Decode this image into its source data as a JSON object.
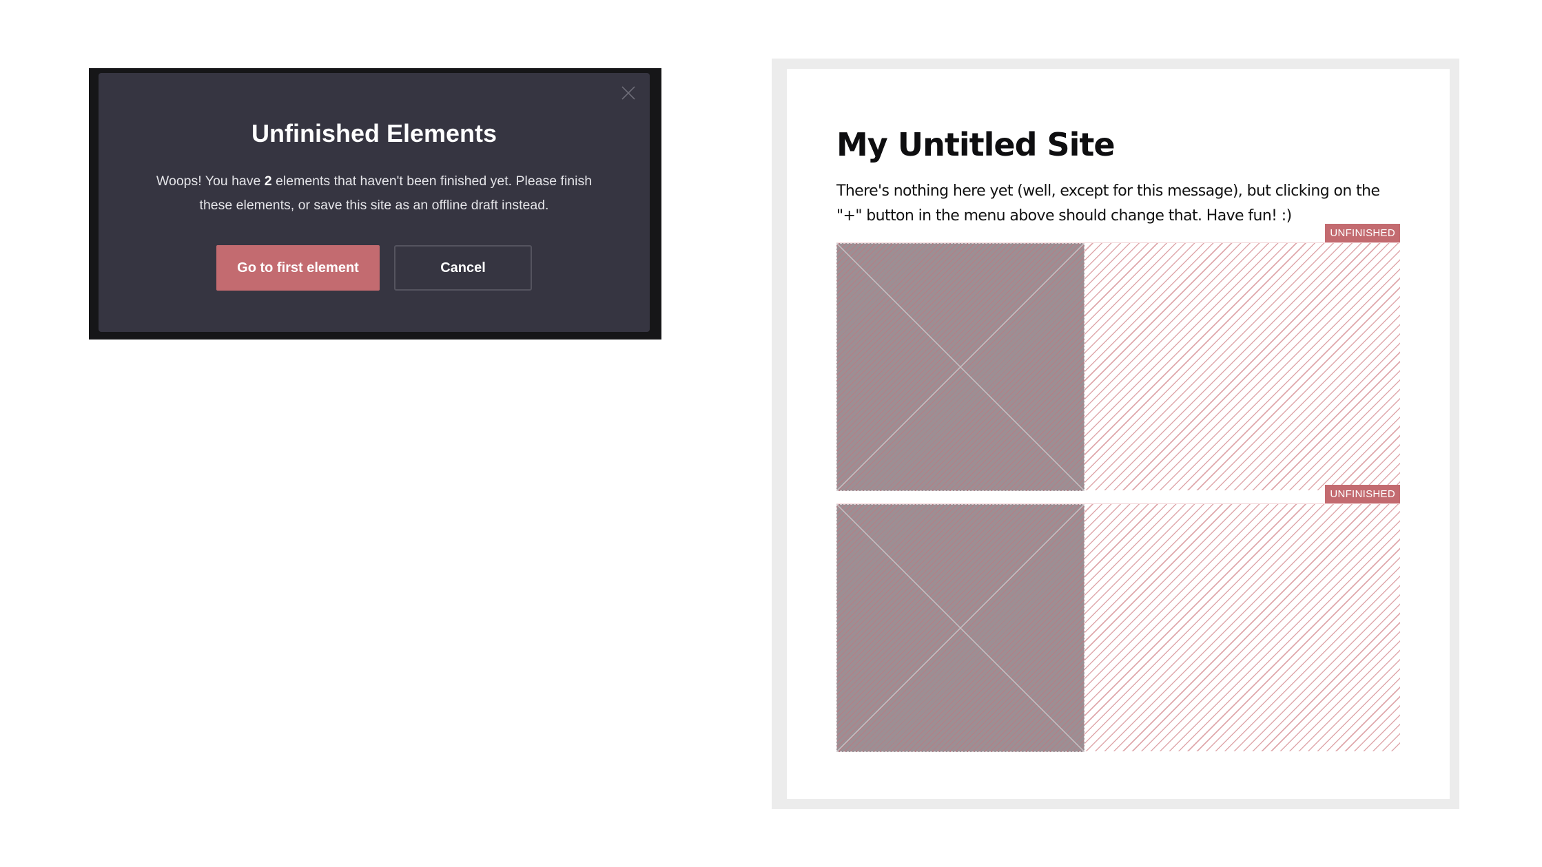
{
  "modal": {
    "title": "Unfinished Elements",
    "message_before": "Woops! You have ",
    "count": "2",
    "message_after": " elements that haven't been finished yet. Please finish these elements, or save this site as an offline draft instead.",
    "primary_button": "Go to first element",
    "secondary_button": "Cancel",
    "close_icon": "close-icon"
  },
  "site": {
    "title": "My Untitled Site",
    "text": "There's nothing here yet (well, except for this message), but clicking on the \"+\" button in the menu above should change that. Have fun! :)",
    "blocks": [
      {
        "badge": "UNFINISHED",
        "image_icon": "image-placeholder-icon"
      },
      {
        "badge": "UNFINISHED",
        "image_icon": "image-placeholder-icon"
      }
    ]
  },
  "colors": {
    "modal_bg": "#363541",
    "accent": "#c36b70",
    "frame_bg": "#ececec"
  }
}
